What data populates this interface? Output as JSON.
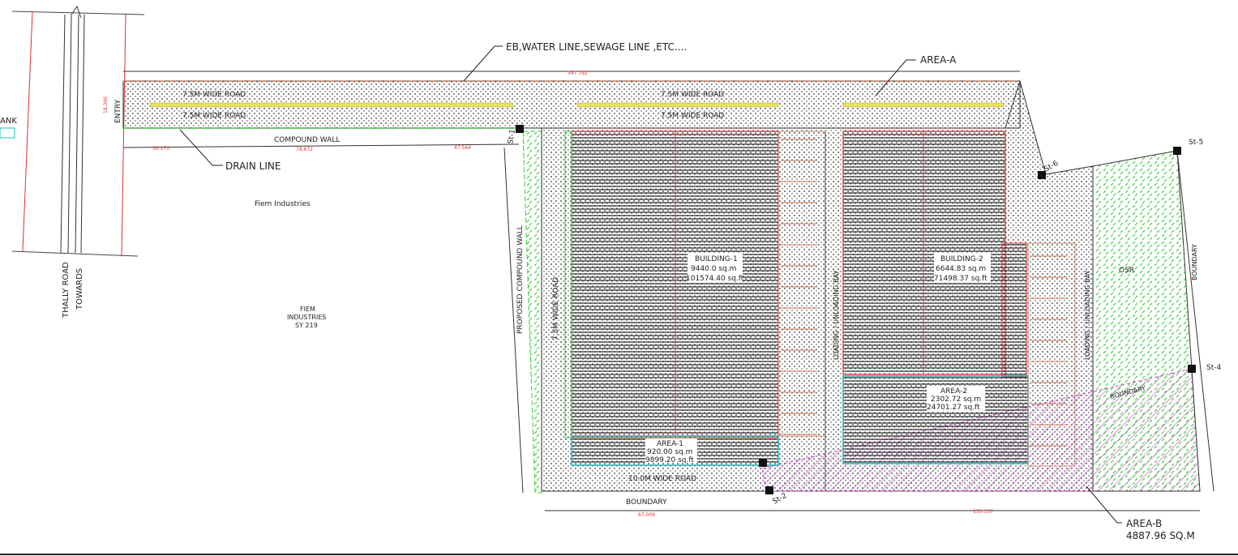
{
  "annotations": {
    "services": "EB,WATER LINE,SEWAGE LINE ,ETC....",
    "area_a": "AREA-A",
    "drain_line": "DRAIN LINE",
    "compound_wall": "COMPOUND WALL",
    "entry": "ENTRY",
    "fiem_industries": "Fiem Industries",
    "fiem_block": [
      "FIEM",
      "INDUSTRIES",
      "SY 219"
    ],
    "thally_road": "THALLY ROAD",
    "towards": "TOWARDS",
    "tank": "ANK",
    "proposed_compound_wall": "PROPOSED COMPOUND WALL",
    "boundary_bottom": "BOUNDARY",
    "boundary_right": "BOUNDARY",
    "boundary_diag": "BOUNDARY",
    "osr": "OSR",
    "area_b": [
      "AREA-B",
      "4887.96 SQ.M"
    ]
  },
  "roads": {
    "top_upper_left": "7.5M WIDE ROAD",
    "top_lower_left": "7.5M WIDE ROAD",
    "top_upper_right": "7.5M WIDE ROAD",
    "top_lower_right": "7.5M WIDE ROAD",
    "left_vertical": "7.5M WIDE ROAD",
    "bottom": "10.0M WIDE ROAD"
  },
  "bays": {
    "bay1": "LOADING / UNLOADING BAY",
    "bay2": "LOADING / UNLOADING BAY"
  },
  "buildings": {
    "b1": [
      "BUILDING-1",
      "9440.0 sq.m",
      "101574.40 sq.ft"
    ],
    "b2": [
      "BUILDING-2",
      "6644.83 sq.m",
      "71498.37 sq.ft"
    ]
  },
  "areas": {
    "a1": [
      "AREA-1",
      "920.00 sq.m",
      "9899.20 sq.ft"
    ],
    "a2": [
      "AREA-2",
      "2302.72 sq.m",
      "24701.27 sq.ft"
    ]
  },
  "stations": [
    "St-1",
    "St-2",
    "St-4",
    "St-5",
    "St-6"
  ],
  "dimensions": {
    "top_length": "347.792",
    "seg1": "30.170",
    "seg2": "78,672",
    "seg3": "47.564",
    "bottom1": "67.009",
    "bottom2": "155.337",
    "entry_width": "18.300"
  },
  "colors": {
    "line": "#222222",
    "dim_red": "#e03030",
    "green": "#33cc33",
    "magenta": "#cc44cc",
    "cyan": "#22bbbb",
    "yellow": "#e8e060",
    "road": "#cc7755"
  }
}
